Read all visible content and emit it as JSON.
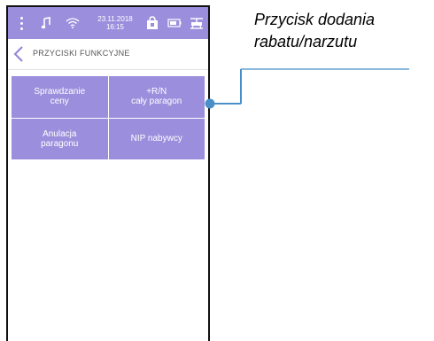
{
  "statusbar": {
    "date": "23.11.2018",
    "time": "16:15",
    "icons": [
      "menu-dots-icon",
      "music-note-icon",
      "wifi-icon",
      "shopping-bag-icon",
      "battery-icon",
      "cash-register-icon"
    ]
  },
  "header": {
    "title": "PRZYCISKI FUNKCYJNE",
    "back_icon": "chevron-left-icon"
  },
  "buttons": [
    {
      "label_line1": "Sprawdzanie",
      "label_line2": "ceny"
    },
    {
      "label_line1": "+R/N",
      "label_line2": "cały paragon"
    },
    {
      "label_line1": "Anulacja",
      "label_line2": "paragonu"
    },
    {
      "label_line1": "NIP nabywcy",
      "label_line2": ""
    }
  ],
  "callout": {
    "line1": "Przycisk dodania",
    "line2": "rabatu/narzutu"
  },
  "colors": {
    "accent": "#9b8fdd",
    "callout_line": "#4a90c8"
  }
}
